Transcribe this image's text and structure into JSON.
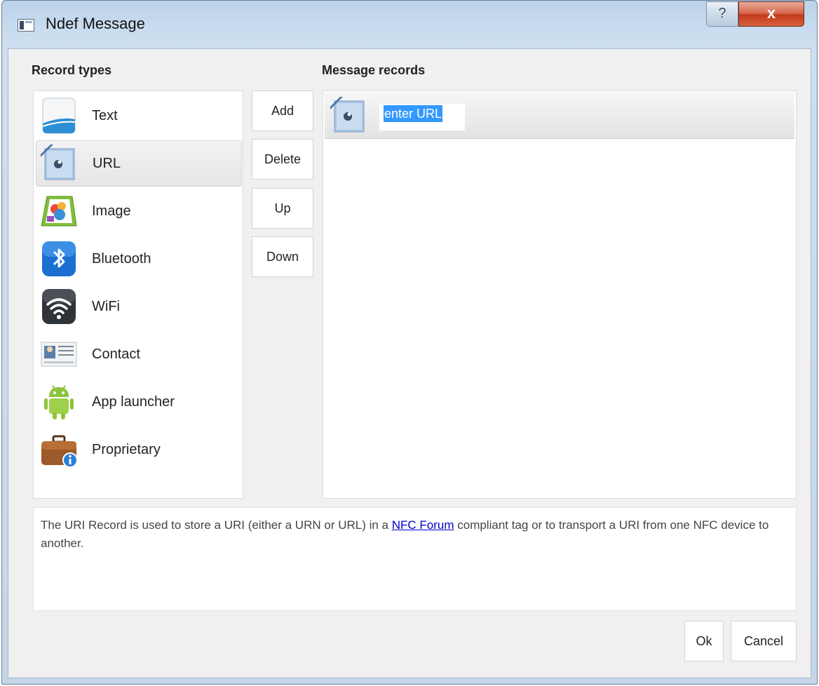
{
  "window": {
    "title": "Ndef Message",
    "help_label": "?",
    "close_label": "x"
  },
  "record_types": {
    "label": "Record types",
    "items": [
      {
        "label": "Text",
        "icon": "text-record-icon"
      },
      {
        "label": "URL",
        "icon": "url-record-icon",
        "selected": true
      },
      {
        "label": "Image",
        "icon": "image-record-icon"
      },
      {
        "label": "Bluetooth",
        "icon": "bluetooth-icon"
      },
      {
        "label": "WiFi",
        "icon": "wifi-icon"
      },
      {
        "label": "Contact",
        "icon": "contact-card-icon"
      },
      {
        "label": "App launcher",
        "icon": "android-icon"
      },
      {
        "label": "Proprietary",
        "icon": "briefcase-icon"
      }
    ]
  },
  "actions": {
    "add": "Add",
    "delete": "Delete",
    "up": "Up",
    "down": "Down"
  },
  "message_records": {
    "label": "Message records",
    "records": [
      {
        "icon": "url-record-icon",
        "value": "enter URL"
      }
    ]
  },
  "description": {
    "before": "The URI Record is used to store a URI (either a URN or URL) in a ",
    "link": "NFC Forum",
    "after": " compliant tag or to transport a URI from one NFC device to another."
  },
  "footer": {
    "ok": "Ok",
    "cancel": "Cancel"
  },
  "colors": {
    "selection": "#3399ff",
    "link": "#0000cc",
    "close": "#c9432a"
  }
}
